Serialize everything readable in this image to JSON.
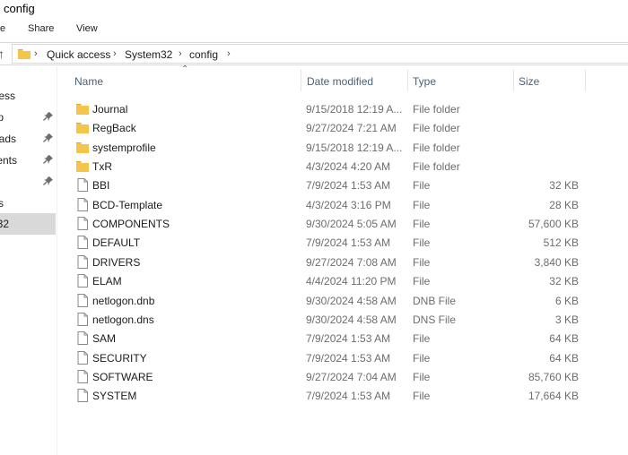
{
  "window": {
    "title": "config"
  },
  "ribbon": {
    "tabs": [
      "e",
      "Share",
      "View"
    ]
  },
  "address": {
    "crumbs": [
      "Quick access",
      "System32",
      "config"
    ]
  },
  "nav": {
    "items": [
      {
        "label": "ess",
        "pinned": false
      },
      {
        "label": "p",
        "pinned": true
      },
      {
        "label": "ads",
        "pinned": true
      },
      {
        "label": "ents",
        "pinned": true
      },
      {
        "label": "",
        "pinned": true
      },
      {
        "label": "s",
        "pinned": false
      },
      {
        "label": "32",
        "pinned": false,
        "selected": true
      }
    ]
  },
  "columns": {
    "name": "Name",
    "date": "Date modified",
    "type": "Type",
    "size": "Size"
  },
  "files": [
    {
      "name": "Journal",
      "date": "9/15/2018 12:19 A...",
      "type": "File folder",
      "size": "",
      "kind": "folder"
    },
    {
      "name": "RegBack",
      "date": "9/27/2024 7:21 AM",
      "type": "File folder",
      "size": "",
      "kind": "folder"
    },
    {
      "name": "systemprofile",
      "date": "9/15/2018 12:19 A...",
      "type": "File folder",
      "size": "",
      "kind": "folder"
    },
    {
      "name": "TxR",
      "date": "4/3/2024 4:20 AM",
      "type": "File folder",
      "size": "",
      "kind": "folder"
    },
    {
      "name": "BBI",
      "date": "7/9/2024 1:53 AM",
      "type": "File",
      "size": "32 KB",
      "kind": "file"
    },
    {
      "name": "BCD-Template",
      "date": "4/3/2024 3:16 PM",
      "type": "File",
      "size": "28 KB",
      "kind": "file"
    },
    {
      "name": "COMPONENTS",
      "date": "9/30/2024 5:05 AM",
      "type": "File",
      "size": "57,600 KB",
      "kind": "file"
    },
    {
      "name": "DEFAULT",
      "date": "7/9/2024 1:53 AM",
      "type": "File",
      "size": "512 KB",
      "kind": "file"
    },
    {
      "name": "DRIVERS",
      "date": "9/27/2024 7:08 AM",
      "type": "File",
      "size": "3,840 KB",
      "kind": "file"
    },
    {
      "name": "ELAM",
      "date": "4/4/2024 11:20 PM",
      "type": "File",
      "size": "32 KB",
      "kind": "file"
    },
    {
      "name": "netlogon.dnb",
      "date": "9/30/2024 4:58 AM",
      "type": "DNB File",
      "size": "6 KB",
      "kind": "file"
    },
    {
      "name": "netlogon.dns",
      "date": "9/30/2024 4:58 AM",
      "type": "DNS File",
      "size": "3 KB",
      "kind": "file"
    },
    {
      "name": "SAM",
      "date": "7/9/2024 1:53 AM",
      "type": "File",
      "size": "64 KB",
      "kind": "file"
    },
    {
      "name": "SECURITY",
      "date": "7/9/2024 1:53 AM",
      "type": "File",
      "size": "64 KB",
      "kind": "file"
    },
    {
      "name": "SOFTWARE",
      "date": "9/27/2024 7:04 AM",
      "type": "File",
      "size": "85,760 KB",
      "kind": "file"
    },
    {
      "name": "SYSTEM",
      "date": "7/9/2024 1:53 AM",
      "type": "File",
      "size": "17,664 KB",
      "kind": "file"
    }
  ],
  "colors": {
    "folder": "#f4c54a",
    "folder_dark": "#dcaa2c",
    "header_text": "#4c607a",
    "selected": "#d9d9d9"
  }
}
